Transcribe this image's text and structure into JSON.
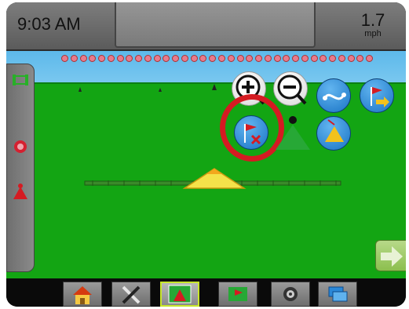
{
  "header": {
    "time": "9:03 AM",
    "speed_value": "1.7",
    "speed_unit": "mph"
  },
  "boom": {
    "section_count": 34,
    "section_color": "#e87a8c"
  },
  "map_controls": {
    "zoom_in_icon": "magnifier-plus-icon",
    "zoom_out_icon": "magnifier-minus-icon",
    "view_toggle_icon": "curve-line-icon",
    "marker_icon": "flag-arrow-icon",
    "delete_marker_icon": "flag-delete-icon",
    "vehicle_view_icon": "vehicle-perspective-icon",
    "heading_icon": "heading-triangle-icon",
    "highlight_color": "#d51b22"
  },
  "left_tray": {
    "items": [
      "boundary-icon",
      "rain-icon",
      "vehicle-icon"
    ]
  },
  "toolbar": {
    "items": [
      "home",
      "tools",
      "guidance",
      "markers",
      "camera",
      "layers"
    ],
    "active": "guidance"
  },
  "colors": {
    "field": "#13a513",
    "sky": "#6cc0ee",
    "accent_active": "#c8e62a",
    "button_blue": "#1a74c5"
  }
}
